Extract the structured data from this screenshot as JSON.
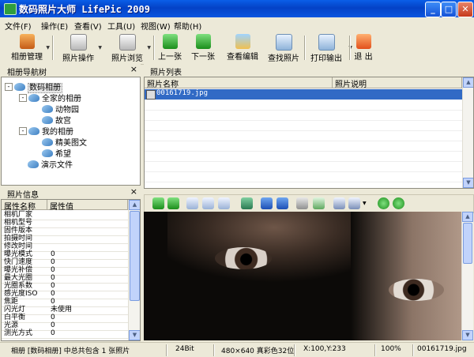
{
  "window": {
    "title": "数码照片大师 LifePic 2009"
  },
  "menu": [
    "文件(F)",
    "操作(E)",
    "查看(V)",
    "工具(U)",
    "视图(W)",
    "帮助(H)"
  ],
  "toolbar": {
    "album_manage": "相册管理",
    "photo_ops": "照片操作",
    "photo_browse": "照片浏览",
    "prev": "上一张",
    "next": "下一张",
    "view_edit": "查看编辑",
    "find": "查找照片",
    "print": "打印输出",
    "exit": "退 出"
  },
  "nav_panel": {
    "title": "相册导航树",
    "close": "×",
    "tree": [
      {
        "label": "数码相册",
        "toggle": "-"
      },
      {
        "label": "全家的相册",
        "toggle": "-"
      },
      {
        "label": "动物园",
        "toggle": ""
      },
      {
        "label": "故宫",
        "toggle": ""
      },
      {
        "label": "我的相册",
        "toggle": "-"
      },
      {
        "label": "精美图文",
        "toggle": ""
      },
      {
        "label": "希望",
        "toggle": ""
      },
      {
        "label": "演示文件",
        "toggle": ""
      }
    ]
  },
  "info_panel": {
    "title": "照片信息",
    "close": "×",
    "columns": [
      "属性名称",
      "属性值"
    ],
    "rows": [
      {
        "name": "相机厂家",
        "value": ""
      },
      {
        "name": "相机型号",
        "value": ""
      },
      {
        "name": "固件版本",
        "value": ""
      },
      {
        "name": "拍摄时间",
        "value": ""
      },
      {
        "name": "修改时间",
        "value": ""
      },
      {
        "name": "曝光模式",
        "value": "0"
      },
      {
        "name": "快门速度",
        "value": "0"
      },
      {
        "name": "曝光补偿",
        "value": "0"
      },
      {
        "name": "最大光圈",
        "value": "0"
      },
      {
        "name": "光圈系数",
        "value": "0"
      },
      {
        "name": "感光度ISO",
        "value": "0"
      },
      {
        "name": "焦距",
        "value": "0"
      },
      {
        "name": "闪光灯",
        "value": "未使用"
      },
      {
        "name": "白平衡",
        "value": "0"
      },
      {
        "name": "光源",
        "value": "0"
      },
      {
        "name": "测光方式",
        "value": "0"
      }
    ]
  },
  "list_panel": {
    "title": "照片列表",
    "columns": [
      "照片名称",
      "照片说明"
    ],
    "files": [
      {
        "name": "00161719.jpg",
        "desc": ""
      }
    ]
  },
  "status": {
    "summary": "相册 [数码相册] 中总共包含 1 张照片",
    "bits": "24Bit",
    "dimensions": "480×640 真彩色32位",
    "coords": "X:100,Y:233",
    "zoom": "100%",
    "filename": "00161719.jpg"
  }
}
